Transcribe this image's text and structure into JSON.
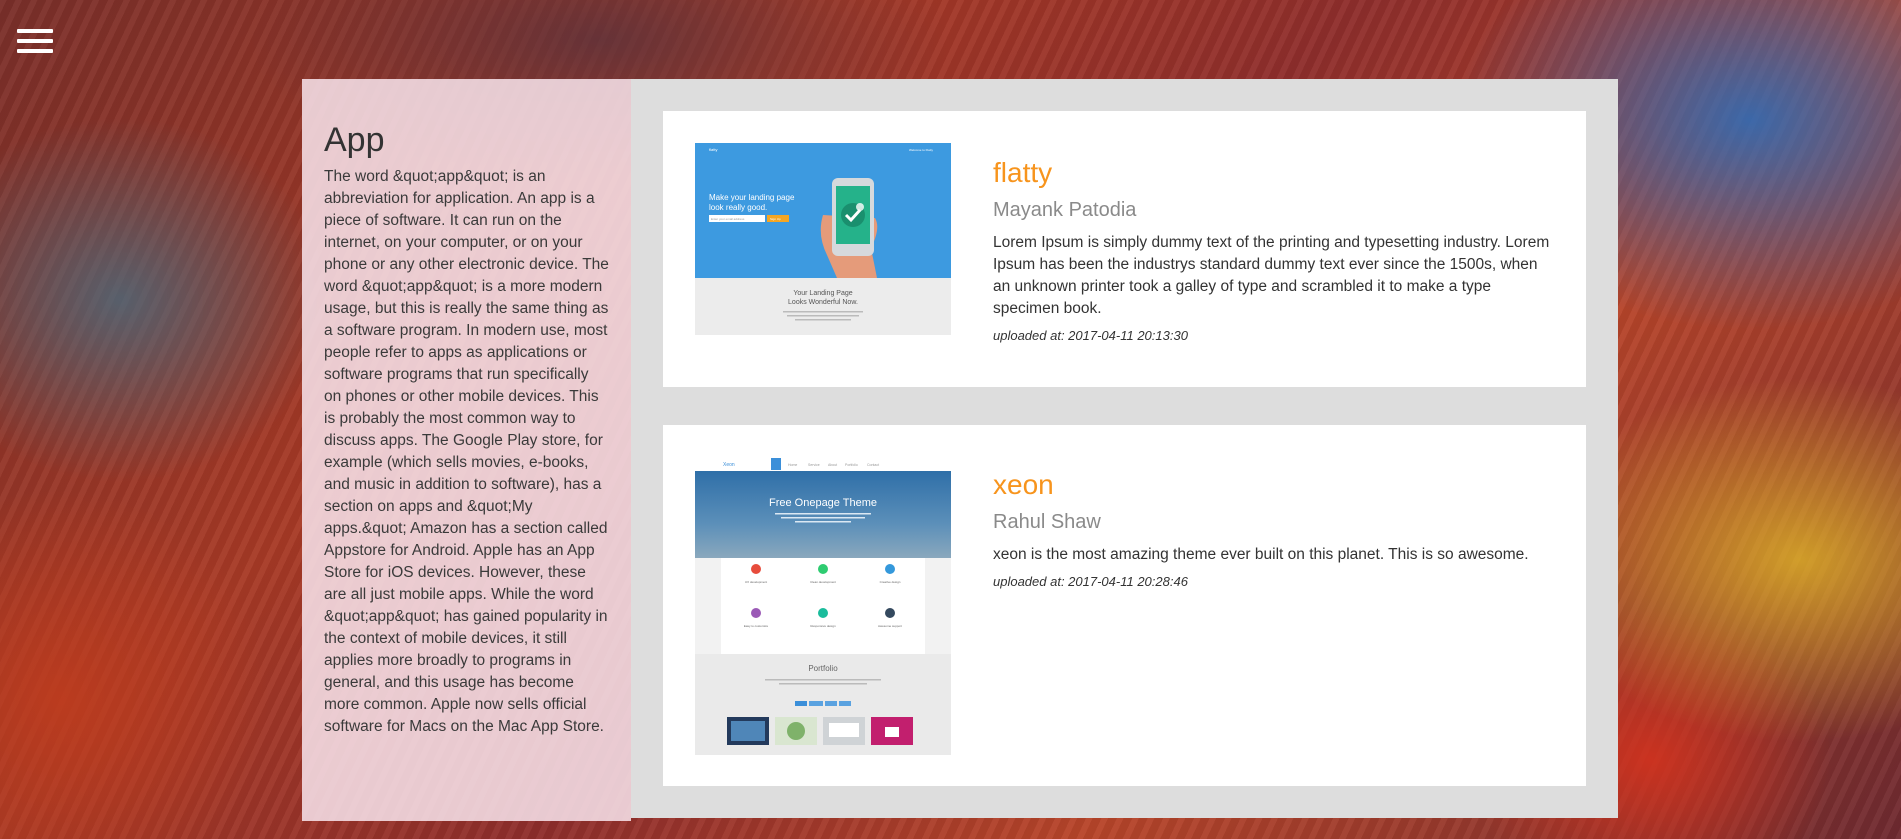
{
  "sidebar": {
    "title": "App",
    "body": "The word &quot;app&quot; is an abbreviation for application. An app is a piece of software. It can run on the internet, on your computer, or on your phone or any other electronic device. The word &quot;app&quot; is a more modern usage, but this is really the same thing as a software program.   In modern use, most people refer to apps as applications or software programs that run specifically on phones or other mobile devices.  This is probably the most common way to discuss apps. The Google Play store, for example (which sells movies, e-books, and music in addition to software), has a section on apps and &quot;My apps.&quot; Amazon has a section called Appstore for Android. Apple has an App Store for iOS devices. However, these are all just mobile apps.  While the word &quot;app&quot; has gained popularity in the context of mobile devices, it still applies more broadly to programs in general, and this usage has become more common. Apple now sells official software for Macs on the Mac App Store."
  },
  "menu": {
    "icon": "hamburger-menu-icon"
  },
  "items": [
    {
      "title": "flatty",
      "author": "Mayank Patodia",
      "description": "Lorem Ipsum is simply dummy text of the printing and typesetting industry. Lorem Ipsum has been the industrys standard dummy text ever since the 1500s, when an unknown printer took a galley of type and scrambled it to make a type specimen book.",
      "uploaded": "uploaded at: 2017-04-11 20:13:30",
      "thumb": {
        "brand": "flatty",
        "header_right": "Welcome to Flatty",
        "hero_line1": "Make your landing page",
        "hero_line2": "look really good.",
        "input_placeholder": "Enter your email address",
        "button": "Sign Up",
        "footer_line1": "Your Landing Page",
        "footer_line2": "Looks Wonderful Now.",
        "footer_text": "It is a long established fact that a reader will be distracted by the readable content of a page when looking at its layout."
      }
    },
    {
      "title": "xeon",
      "author": "Rahul Shaw",
      "description": "xeon is the most amazing theme ever built on this planet. This is so awesome.",
      "uploaded": "uploaded at: 2017-04-11 20:28:46",
      "thumb": {
        "brand": "Xeon",
        "nav": [
          "Home",
          "Service",
          "About",
          "Portfolio",
          "Contact"
        ],
        "hero_title": "Free Onepage Theme",
        "hero_sub": "Cras id nisi quis odio tempor dapibus consequat nec sapien lorem ipsum dolor sit amet",
        "services": [
          "UX development",
          "Clean development",
          "Creative design",
          "Easy to customize",
          "Responsive design",
          "Awesome support"
        ],
        "portfolio": "Portfolio",
        "portfolio_sub": "Lorem ipsum dolor sit amet consectetur adipisicing elit sed do eiusmod tempor",
        "filters": [
          "All",
          "Branding",
          "Design",
          "Photo"
        ]
      }
    }
  ]
}
